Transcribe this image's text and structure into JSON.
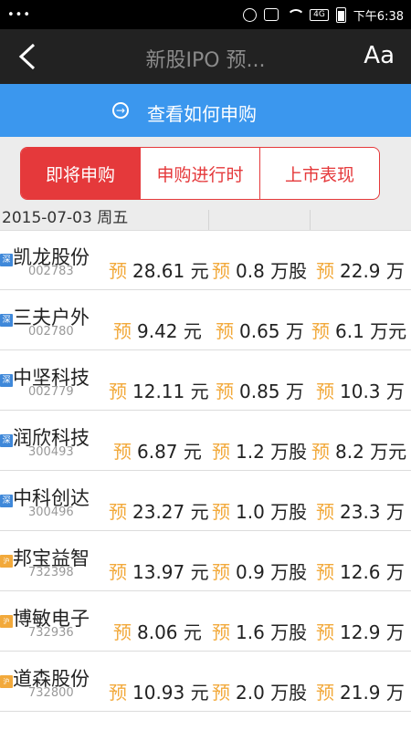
{
  "statusbar": {
    "left": "•••",
    "net_badge": "4G",
    "time": "下午6:38"
  },
  "header": {
    "title": "新股IPO 预...",
    "font_button": "Aa"
  },
  "banner": {
    "arrow": "→",
    "label": "查看如何申购"
  },
  "tabs": [
    {
      "label": "即将申购",
      "active": true
    },
    {
      "label": "申购进行时",
      "active": false
    },
    {
      "label": "上市表现",
      "active": false
    }
  ],
  "date_header": "2015-07-03 周五",
  "prefix": "预",
  "stocks": [
    {
      "market": "深",
      "name": "凯龙股份",
      "code": "002783",
      "price": "28.61 元",
      "shares": "0.8 万股",
      "limit": "22.9 万"
    },
    {
      "market": "深",
      "name": "三夫户外",
      "code": "002780",
      "price": "9.42 元",
      "shares": "0.65 万",
      "limit": "6.1 万元"
    },
    {
      "market": "深",
      "name": "中坚科技",
      "code": "002779",
      "price": "12.11 元",
      "shares": "0.85 万",
      "limit": "10.3 万"
    },
    {
      "market": "深",
      "name": "润欣科技",
      "code": "300493",
      "price": "6.87 元",
      "shares": "1.2 万股",
      "limit": "8.2 万元"
    },
    {
      "market": "深",
      "name": "中科创达",
      "code": "300496",
      "price": "23.27 元",
      "shares": "1.0 万股",
      "limit": "23.3 万"
    },
    {
      "market": "沪",
      "name": "邦宝益智",
      "code": "732398",
      "price": "13.97 元",
      "shares": "0.9 万股",
      "limit": "12.6 万"
    },
    {
      "market": "沪",
      "name": "博敏电子",
      "code": "732936",
      "price": "8.06 元",
      "shares": "1.6 万股",
      "limit": "12.9 万"
    },
    {
      "market": "沪",
      "name": "道森股份",
      "code": "732800",
      "price": "10.93 元",
      "shares": "2.0 万股",
      "limit": "21.9 万"
    }
  ],
  "colors": {
    "accent_red": "#e5393b",
    "banner_blue": "#3b97ee",
    "prefix_orange": "#f2a93b",
    "titlebar": "#222222"
  }
}
